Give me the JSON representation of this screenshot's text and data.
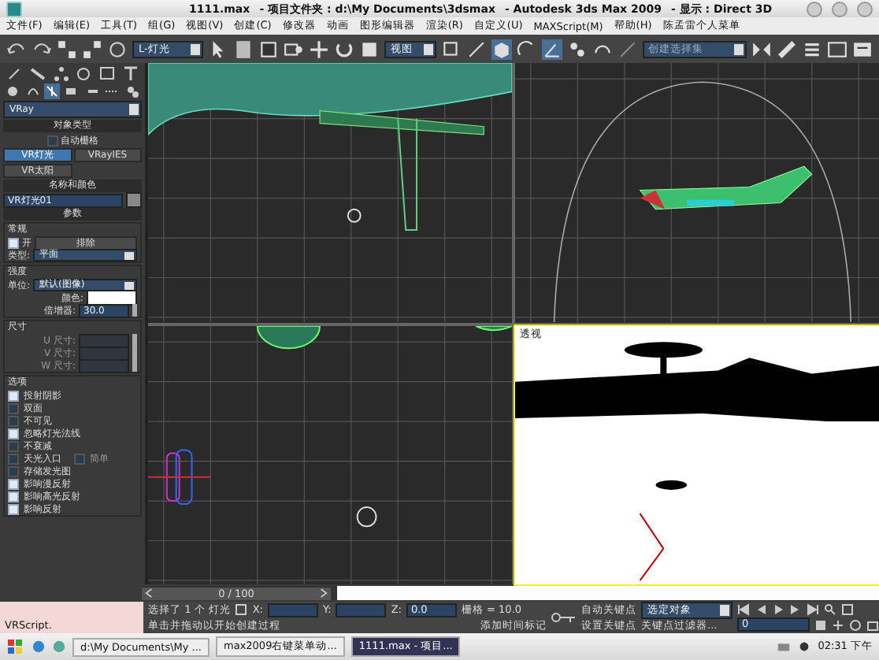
{
  "window": {
    "file": "1111.max",
    "project": "- 项目文件夹 : d:\\My Documents\\3dsmax",
    "app": "- Autodesk 3ds Max  2009",
    "display": "- 显示 : Direct 3D"
  },
  "menu": [
    "文件(F)",
    "编辑(E)",
    "工具(T)",
    "组(G)",
    "视图(V)",
    "创建(C)",
    "修改器",
    "动画",
    "图形编辑器",
    "渲染(R)",
    "自定义(U)",
    "MAXScript(M)",
    "帮助(H)",
    "陈孟雷个人菜单"
  ],
  "toolbar": {
    "layer_dropdown": "L-灯光",
    "view_dropdown": "视图",
    "selection_set_placeholder": "创建选择集"
  },
  "panel": {
    "category": "VRay",
    "object_type": {
      "title": "对象类型",
      "autogrid": {
        "label": "自动栅格",
        "checked": false
      },
      "buttons": [
        {
          "label": "VR灯光",
          "selected": true
        },
        {
          "label": "VRayIES",
          "selected": false
        },
        {
          "label": "VR太阳",
          "selected": false
        }
      ]
    },
    "name_color": {
      "title": "名称和颜色",
      "name": "VR灯光01"
    },
    "params": {
      "title": "参数",
      "general": "常规",
      "on": {
        "label": "开",
        "checked": true
      },
      "exclude": "排除",
      "type_label": "类型:",
      "type": "平面",
      "intensity": "强度",
      "unit_label": "单位:",
      "unit": "默认(图像)",
      "color_label": "颜色:",
      "multiplier_label": "倍增器:",
      "multiplier": "30.0",
      "size": "尺寸",
      "size_labels": [
        "U 尺寸:",
        "V 尺寸:",
        "W 尺寸:"
      ],
      "options_title": "选项",
      "options": [
        {
          "label": "投射阴影",
          "checked": true
        },
        {
          "label": "双面",
          "checked": false
        },
        {
          "label": "不可见",
          "checked": false
        },
        {
          "label": "忽略灯光法线",
          "checked": true
        },
        {
          "label": "不衰减",
          "checked": false
        },
        {
          "label": "天光入口",
          "checked": false,
          "extra": {
            "label": "简单",
            "checked": false
          }
        },
        {
          "label": "存储发光图",
          "checked": false
        },
        {
          "label": "影响漫反射",
          "checked": true
        },
        {
          "label": "影响高光反射",
          "checked": true
        },
        {
          "label": "影响反射",
          "checked": true
        }
      ]
    }
  },
  "viewports": [
    {
      "kind": "wire"
    },
    {
      "kind": "front"
    },
    {
      "kind": "wheels"
    },
    {
      "kind": "persp",
      "label": "透视"
    }
  ],
  "timeline": {
    "position": "0 / 100"
  },
  "status": {
    "script": "VRScript.",
    "selected": "选择了 1 个 灯光",
    "prompt": "单击并拖动以开始创建过程",
    "x": "X:",
    "y": "Y:",
    "z": "Z:",
    "z_value": "0.0",
    "grid": "栅格 = 10.0",
    "time_tag": "添加时间标记",
    "auto_key": "自动关键点",
    "key_set": "选定对象",
    "set_key": "设置关键点",
    "key_filters": "关键点过滤器...",
    "frame": "0"
  },
  "taskbar": {
    "items": [
      {
        "label": "d:\\My Documents\\My ...",
        "selected": false
      },
      {
        "label": "max2009右键菜单动...",
        "selected": false
      },
      {
        "label": "1111.max  - 项目...",
        "selected": true
      }
    ],
    "clock": "02:31 下午"
  }
}
